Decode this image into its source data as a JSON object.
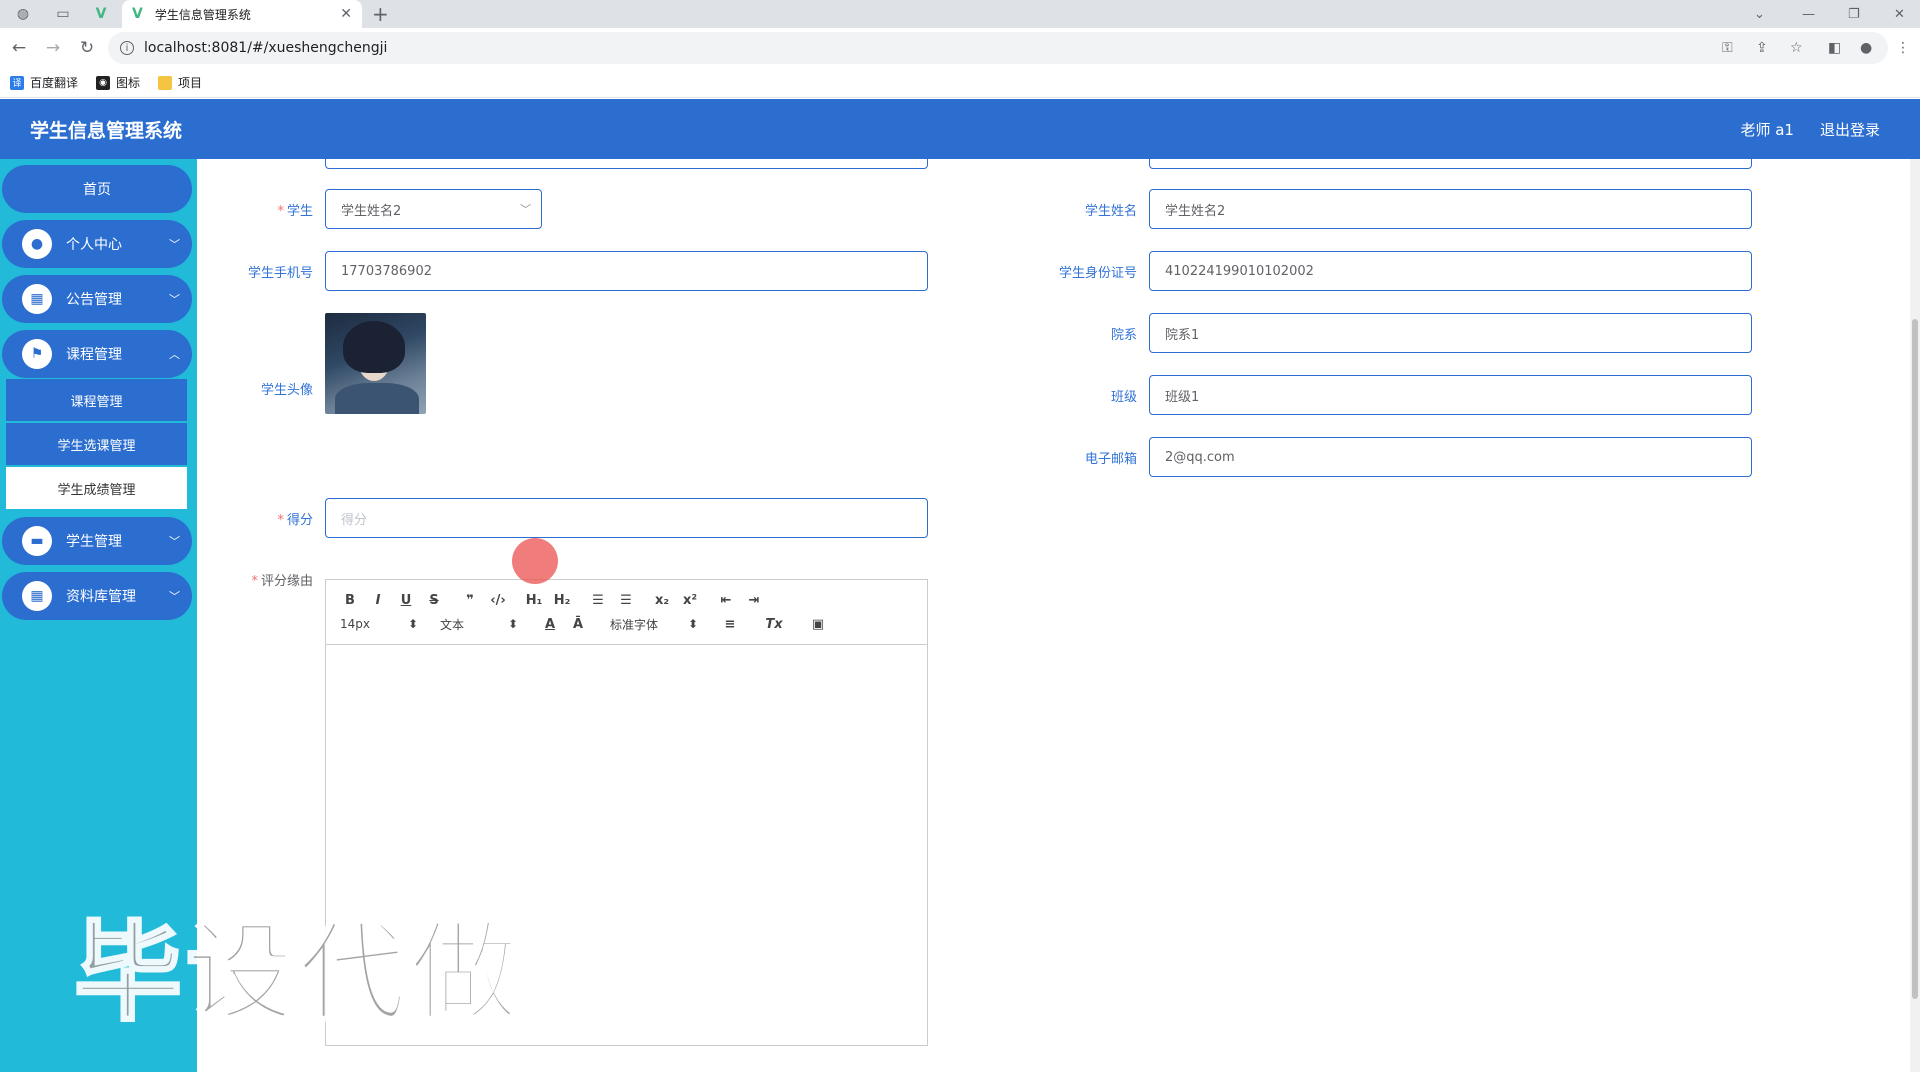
{
  "browser": {
    "tab_title": "学生信息管理系统",
    "url": "localhost:8081/#/xueshengchengji",
    "bookmarks": [
      "百度翻译",
      "图标",
      "项目"
    ]
  },
  "header": {
    "title": "学生信息管理系统",
    "user": "老师 a1",
    "logout": "退出登录"
  },
  "sidebar": {
    "home": "首页",
    "items": [
      "个人中心",
      "公告管理",
      "课程管理",
      "学生管理",
      "资料库管理"
    ],
    "sub_items": [
      "课程管理",
      "学生选课管理",
      "学生成绩管理"
    ]
  },
  "form": {
    "student_label": "学生",
    "student_value": "学生姓名2",
    "phone_label": "学生手机号",
    "phone_value": "17703786902",
    "avatar_label": "学生头像",
    "score_label": "得分",
    "score_placeholder": "得分",
    "reason_label": "评分缘由",
    "name_label": "学生姓名",
    "name_value": "学生姓名2",
    "id_label": "学生身份证号",
    "id_value": "410224199010102002",
    "dept_label": "院系",
    "dept_value": "院系1",
    "class_label": "班级",
    "class_value": "班级1",
    "email_label": "电子邮箱",
    "email_value": "2@qq.com"
  },
  "editor": {
    "font_size": "14px",
    "header_type": "文本",
    "font_family": "标准字体"
  },
  "watermark": "毕设代做",
  "colors": {
    "header_blue": "#2b6ed0",
    "sidebar_cyan": "#21bbd9",
    "label_blue": "#3273d8"
  }
}
